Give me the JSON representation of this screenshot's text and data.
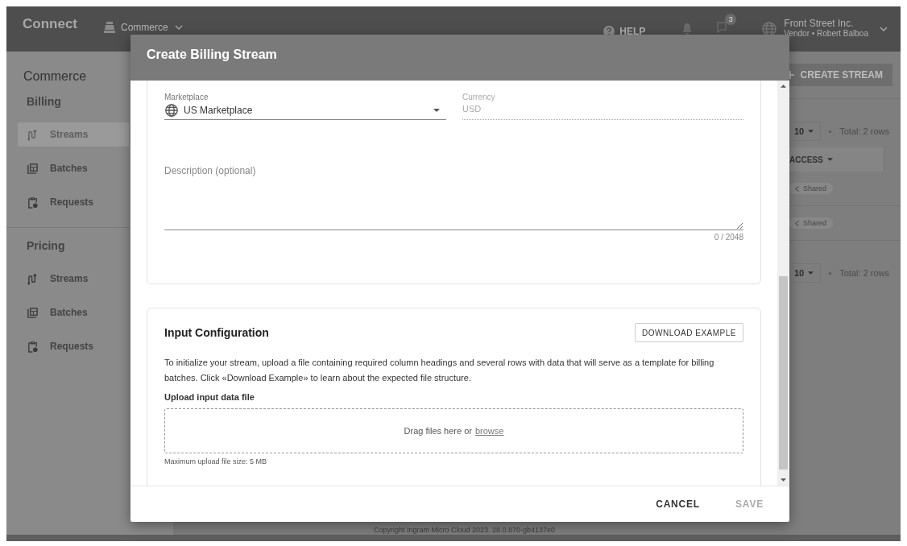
{
  "topbar": {
    "brand": "Connect",
    "module": "Commerce",
    "help": "HELP",
    "messages_badge": "3",
    "account": {
      "name": "Front Street Inc.",
      "detail": "Vendor • Robert Balboa"
    }
  },
  "sidebar": {
    "title": "Commerce",
    "sections": [
      {
        "title": "Billing",
        "items": [
          {
            "label": "Streams",
            "kind": "streams",
            "selected": true
          },
          {
            "label": "Batches",
            "kind": "batches",
            "selected": false
          },
          {
            "label": "Requests",
            "kind": "requests",
            "selected": false
          }
        ]
      },
      {
        "title": "Pricing",
        "items": [
          {
            "label": "Streams",
            "kind": "streams",
            "selected": false
          },
          {
            "label": "Batches",
            "kind": "batches",
            "selected": false
          },
          {
            "label": "Requests",
            "kind": "requests",
            "selected": false
          }
        ]
      }
    ]
  },
  "content": {
    "create_button": "CREATE STREAM",
    "pagination_top": {
      "page_size": "10",
      "total": "Total: 2 rows"
    },
    "table": {
      "columns": [
        "ACCESS"
      ],
      "rows": [
        {
          "access": "Shared"
        },
        {
          "access": "Shared"
        }
      ]
    },
    "pagination_bottom": {
      "page_size": "10",
      "total": "Total: 2 rows"
    },
    "footer": "Copyright Ingram Micro Cloud 2023. 28.0.870-gb4137e0"
  },
  "dialog": {
    "title": "Create Billing Stream",
    "marketplace": {
      "label": "Marketplace",
      "value": "US Marketplace"
    },
    "currency": {
      "label": "Currency",
      "value": "USD",
      "disabled": true
    },
    "description": {
      "placeholder": "Description (optional)",
      "counter": "0 / 2048"
    },
    "input_configuration": {
      "title": "Input Configuration",
      "download_button": "DOWNLOAD EXAMPLE",
      "text": "To initialize your stream, upload a file containing required column headings and several rows with data that will serve as a template for billing batches. Click «Download Example» to learn about the expected file structure.",
      "upload_label": "Upload input data file",
      "dropzone_text": "Drag files here or",
      "browse_link": "browse",
      "hint": "Maximum upload file size: 5 MB"
    },
    "buttons": [
      {
        "label": "CANCEL",
        "disabled": false
      },
      {
        "label": "SAVE",
        "disabled": true
      }
    ]
  }
}
